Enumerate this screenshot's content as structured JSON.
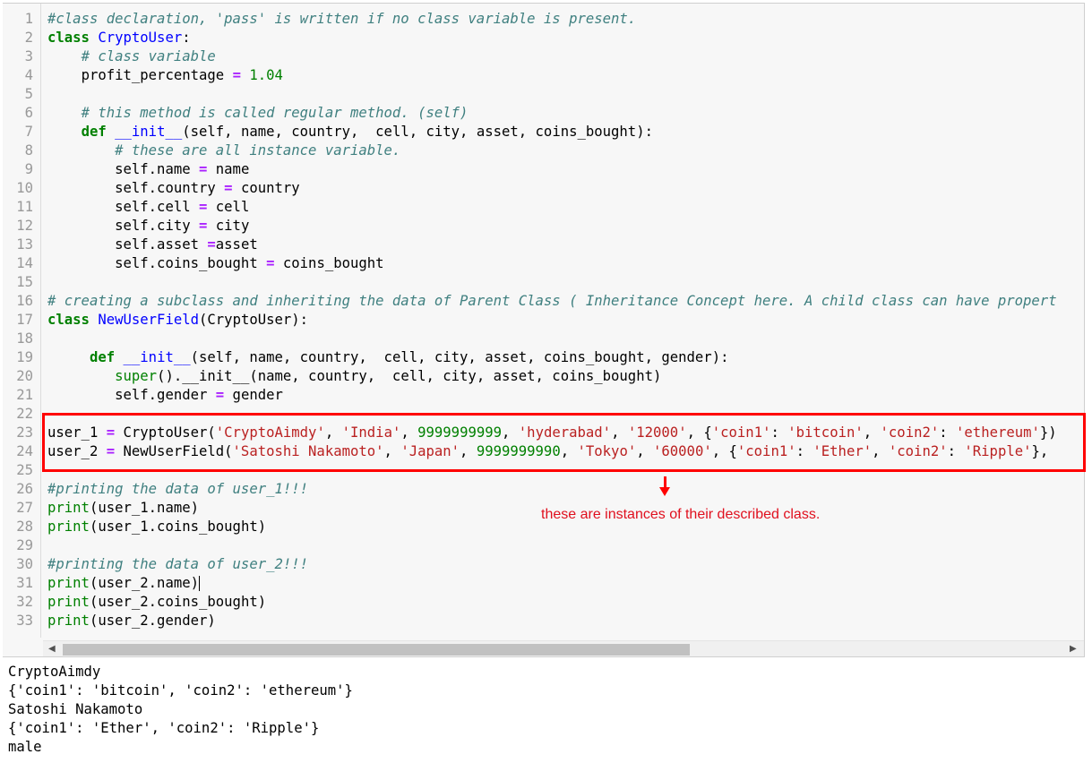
{
  "code_lines": [
    {
      "n": "1",
      "c": "#class declaration, 'pass' is written if no class variable is present."
    },
    {
      "n": "2"
    },
    {
      "n": "3"
    },
    {
      "n": "4"
    },
    {
      "n": "5"
    },
    {
      "n": "6"
    },
    {
      "n": "7"
    },
    {
      "n": "8"
    },
    {
      "n": "9"
    },
    {
      "n": "10"
    },
    {
      "n": "11"
    },
    {
      "n": "12"
    },
    {
      "n": "13"
    },
    {
      "n": "14"
    },
    {
      "n": "15"
    },
    {
      "n": "16"
    },
    {
      "n": "17"
    },
    {
      "n": "18"
    },
    {
      "n": "19"
    },
    {
      "n": "20"
    },
    {
      "n": "21"
    },
    {
      "n": "22"
    },
    {
      "n": "23"
    },
    {
      "n": "24"
    },
    {
      "n": "25"
    },
    {
      "n": "26"
    },
    {
      "n": "27"
    },
    {
      "n": "28"
    },
    {
      "n": "29"
    },
    {
      "n": "30"
    },
    {
      "n": "31"
    },
    {
      "n": "32"
    },
    {
      "n": "33"
    }
  ],
  "code": {
    "l1": "#class declaration, 'pass' is written if no class variable is present.",
    "l2_kw": "class",
    "l2_name": "CryptoUser",
    "l2_rest": ":",
    "l3": "# class variable",
    "l4_a": "profit_percentage ",
    "l4_op": "=",
    "l4_num": " 1.04",
    "l6": "# this method is called regular method. (self)",
    "l7_kw": "def",
    "l7_fn": "__init__",
    "l7_rest": "(self, name, country,  cell, city, asset, coins_bought):",
    "l8": "# these are all instance variable.",
    "l9_a": "self.name ",
    "l9_b": " name",
    "l10_a": "self.country ",
    "l10_b": " country",
    "l11_a": "self.cell ",
    "l11_b": " cell",
    "l12_a": "self.city ",
    "l12_b": " city",
    "l13_a": "self.asset ",
    "l13_b": "asset",
    "l14_a": "self.coins_bought ",
    "l14_b": " coins_bought",
    "l16": "# creating a subclass and inheriting the data of Parent Class ( Inheritance Concept here. A child class can have propert",
    "l17_kw": "class",
    "l17_name": "NewUserField",
    "l17_rest": "(CryptoUser):",
    "l19_kw": "def",
    "l19_fn": "__init__",
    "l19_rest": "(self, name, country,  cell, city, asset, coins_bought, gender):",
    "l20_bi": "super",
    "l20_rest": "().__init__(name, country,  cell, city, asset, coins_bought)",
    "l21_a": "self.gender ",
    "l21_b": " gender",
    "l23_a": "user_1 ",
    "l23_b": " CryptoUser(",
    "l23_s1": "'CryptoAimdy'",
    "l23_s2": "'India'",
    "l23_n1": "9999999999",
    "l23_s3": "'hyderabad'",
    "l23_s4": "'12000'",
    "l23_s5": "'coin1'",
    "l23_s6": "'bitcoin'",
    "l23_s7": "'coin2'",
    "l23_s8": "'ethereum'",
    "l23_end": "})",
    "l24_a": "user_2 ",
    "l24_b": " NewUserField(",
    "l24_s1": "'Satoshi Nakamoto'",
    "l24_s2": "'Japan'",
    "l24_n1": "9999999990",
    "l24_s3": "'Tokyo'",
    "l24_s4": "'60000'",
    "l24_s5": "'coin1'",
    "l24_s6": "'Ether'",
    "l24_s7": "'coin2'",
    "l24_s8": "'Ripple'",
    "l24_end": "},",
    "l26": "#printing the data of user_1!!!",
    "l27_bi": "print",
    "l27_rest": "(user_1.name)",
    "l28_bi": "print",
    "l28_rest": "(user_1.coins_bought)",
    "l30": "#printing the data of user_2!!!",
    "l31_bi": "print",
    "l31_rest": "(user_2.name)",
    "l32_bi": "print",
    "l32_rest": "(user_2.coins_bought)",
    "l33_bi": "print",
    "l33_rest": "(user_2.gender)"
  },
  "annotation": "these are instances of their described class.",
  "output_lines": [
    "CryptoAimdy",
    "{'coin1': 'bitcoin', 'coin2': 'ethereum'}",
    "Satoshi Nakamoto",
    "{'coin1': 'Ether', 'coin2': 'Ripple'}",
    "male"
  ],
  "colors": {
    "highlight_box": "#ff0000",
    "annotation_text": "#e0101e",
    "comment": "#408080",
    "keyword": "#008000",
    "string": "#ba2121",
    "operator": "#aa22ff"
  },
  "icons": {
    "scroll_left": "scroll-left-arrow-icon",
    "scroll_right": "scroll-right-arrow-icon"
  }
}
